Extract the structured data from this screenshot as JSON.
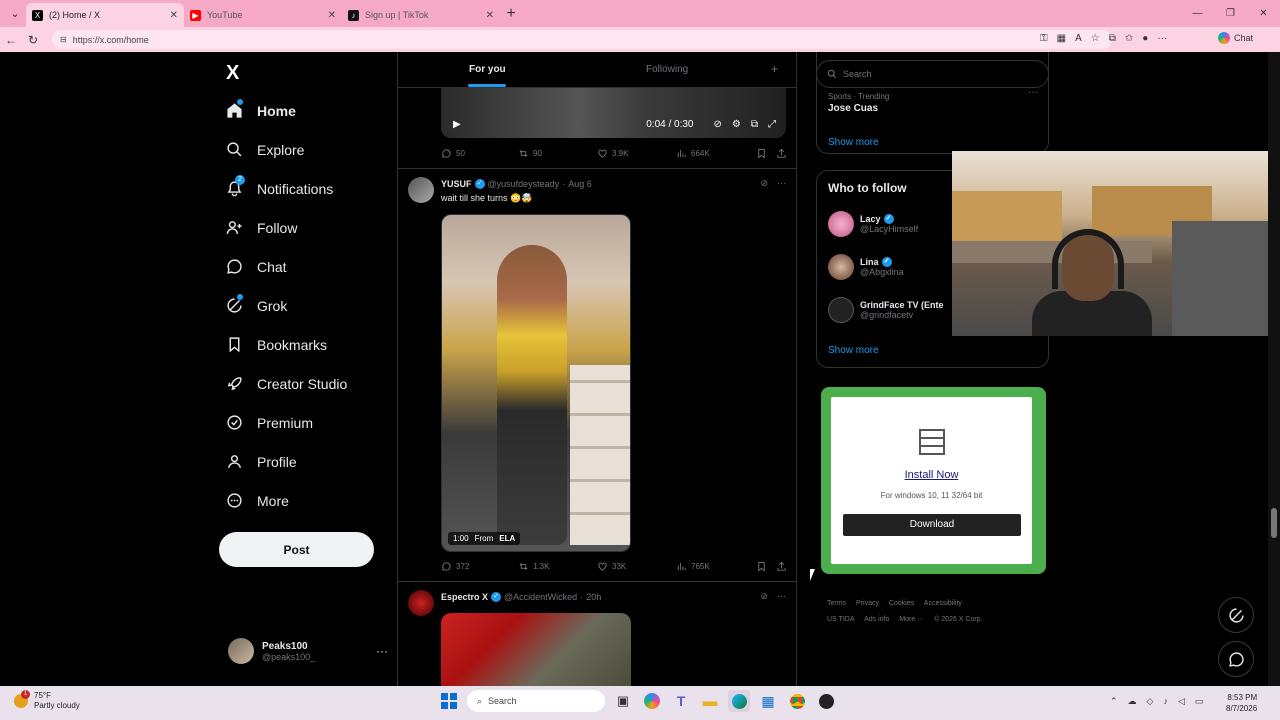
{
  "browser": {
    "tabs": [
      {
        "title": "(2) Home / X",
        "active": true
      },
      {
        "title": "YouTube",
        "active": false
      },
      {
        "title": "Sign up | TikTok",
        "active": false
      }
    ],
    "url": "https://x.com/home",
    "chat_label": "Chat"
  },
  "sidebar": {
    "logo": "X",
    "items": [
      {
        "label": "Home",
        "icon": "home-icon"
      },
      {
        "label": "Explore",
        "icon": "search-icon"
      },
      {
        "label": "Notifications",
        "icon": "bell-icon",
        "badge": "2"
      },
      {
        "label": "Follow",
        "icon": "person-add-icon"
      },
      {
        "label": "Chat",
        "icon": "chat-icon"
      },
      {
        "label": "Grok",
        "icon": "grok-icon"
      },
      {
        "label": "Bookmarks",
        "icon": "bookmark-icon"
      },
      {
        "label": "Creator Studio",
        "icon": "rocket-icon"
      },
      {
        "label": "Premium",
        "icon": "verified-icon"
      },
      {
        "label": "Profile",
        "icon": "person-icon"
      },
      {
        "label": "More",
        "icon": "more-circle-icon"
      }
    ],
    "post_label": "Post",
    "account": {
      "name": "Peaks100",
      "handle": "@peaks100_"
    }
  },
  "feed": {
    "tabs": {
      "for_you": "For you",
      "following": "Following"
    },
    "video1": {
      "time": "0:04 / 0:30"
    },
    "post1_stats": {
      "replies": "50",
      "reposts": "90",
      "likes": "3.9K",
      "views": "664K"
    },
    "post2": {
      "name": "YUSUF",
      "handle": "@yusufdeysteady",
      "date": "Aug 6",
      "text": "wait till she turns 😳🤯",
      "media_duration": "1:00",
      "media_from": "From",
      "media_source": "ELA",
      "stats": {
        "replies": "372",
        "reposts": "1.3K",
        "likes": "33K",
        "views": "765K"
      }
    },
    "post3": {
      "name": "Espectro X",
      "handle": "@AccidentWicked",
      "date": "20h"
    }
  },
  "right": {
    "search_placeholder": "Search",
    "trend": {
      "meta": "Sports · Trending",
      "name": "Jose Cuas"
    },
    "show_more": "Show more",
    "who_to_follow": {
      "title": "Who to follow",
      "accounts": [
        {
          "name": "Lacy",
          "handle": "@LacyHimself"
        },
        {
          "name": "Lina",
          "handle": "@Abgxlina"
        },
        {
          "name": "GrindFace TV (Ente",
          "handle": "@grindfacetv"
        }
      ]
    },
    "ad": {
      "title": "Install Now",
      "subtitle": "For windows 10, 11 32/64 bit",
      "button": "Download"
    },
    "footer": [
      "Terms",
      "Privacy",
      "Cookies",
      "Accessibility",
      "US TIDA",
      "Ads info",
      "More ···",
      "© 2026 X Corp."
    ]
  },
  "taskbar": {
    "weather_temp": "75°F",
    "weather_desc": "Partly cloudy",
    "weather_badge": "1",
    "search_label": "Search",
    "time": "8:53 PM",
    "date": "8/7/2026"
  },
  "colors": {
    "accent": "#1d9bf0",
    "tabbar": "#f6a9c7",
    "ad_green": "#4cae4c"
  }
}
